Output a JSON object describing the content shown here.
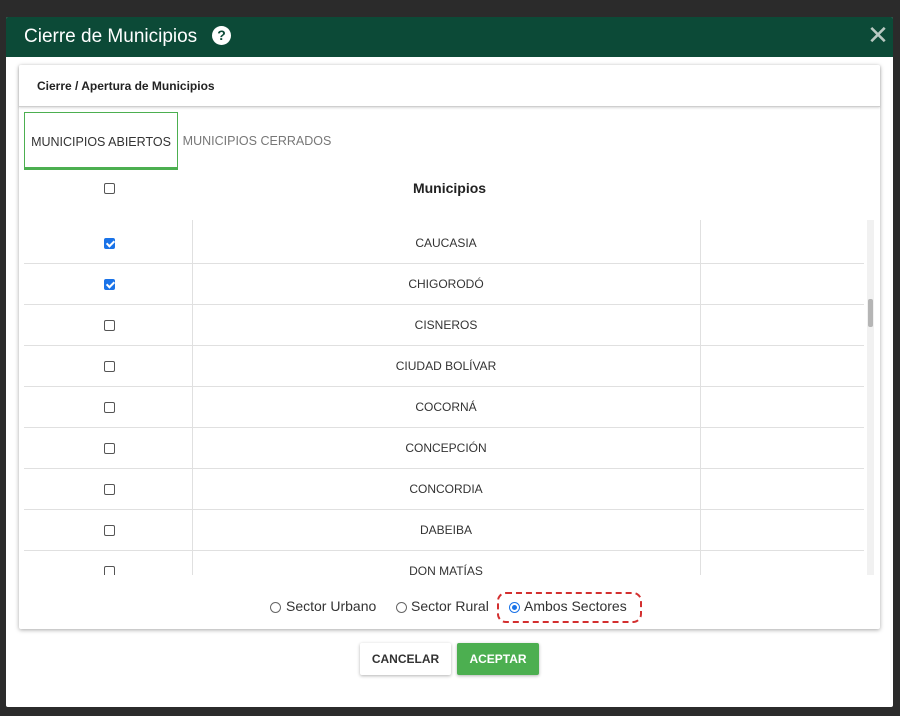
{
  "dialog": {
    "title": "Cierre de Municipios",
    "help_icon": "?",
    "close_icon": "✕"
  },
  "card": {
    "title": "Cierre / Apertura de Municipios"
  },
  "tabs": [
    {
      "label": "MUNICIPIOS ABIERTOS",
      "active": true
    },
    {
      "label": "MUNICIPIOS CERRADOS",
      "active": false
    }
  ],
  "table": {
    "header": "Municipios",
    "select_all_checked": false,
    "rows": [
      {
        "name": "CAUCASIA",
        "checked": true
      },
      {
        "name": "CHIGORODÓ",
        "checked": true
      },
      {
        "name": "CISNEROS",
        "checked": false
      },
      {
        "name": "CIUDAD BOLÍVAR",
        "checked": false
      },
      {
        "name": "COCORNÁ",
        "checked": false
      },
      {
        "name": "CONCEPCIÓN",
        "checked": false
      },
      {
        "name": "CONCORDIA",
        "checked": false
      },
      {
        "name": "DABEIBA",
        "checked": false
      },
      {
        "name": "DON MATÍAS",
        "checked": false
      }
    ]
  },
  "sectors": {
    "options": [
      "Sector Urbano",
      "Sector Rural",
      "Ambos Sectores"
    ],
    "selected": "Ambos Sectores"
  },
  "buttons": {
    "cancel": "CANCELAR",
    "accept": "ACEPTAR"
  },
  "colors": {
    "header_bg": "#0c4a37",
    "accent_green": "#4caf50",
    "checkbox_blue": "#1a73e8",
    "highlight_red": "#d32f2f"
  }
}
